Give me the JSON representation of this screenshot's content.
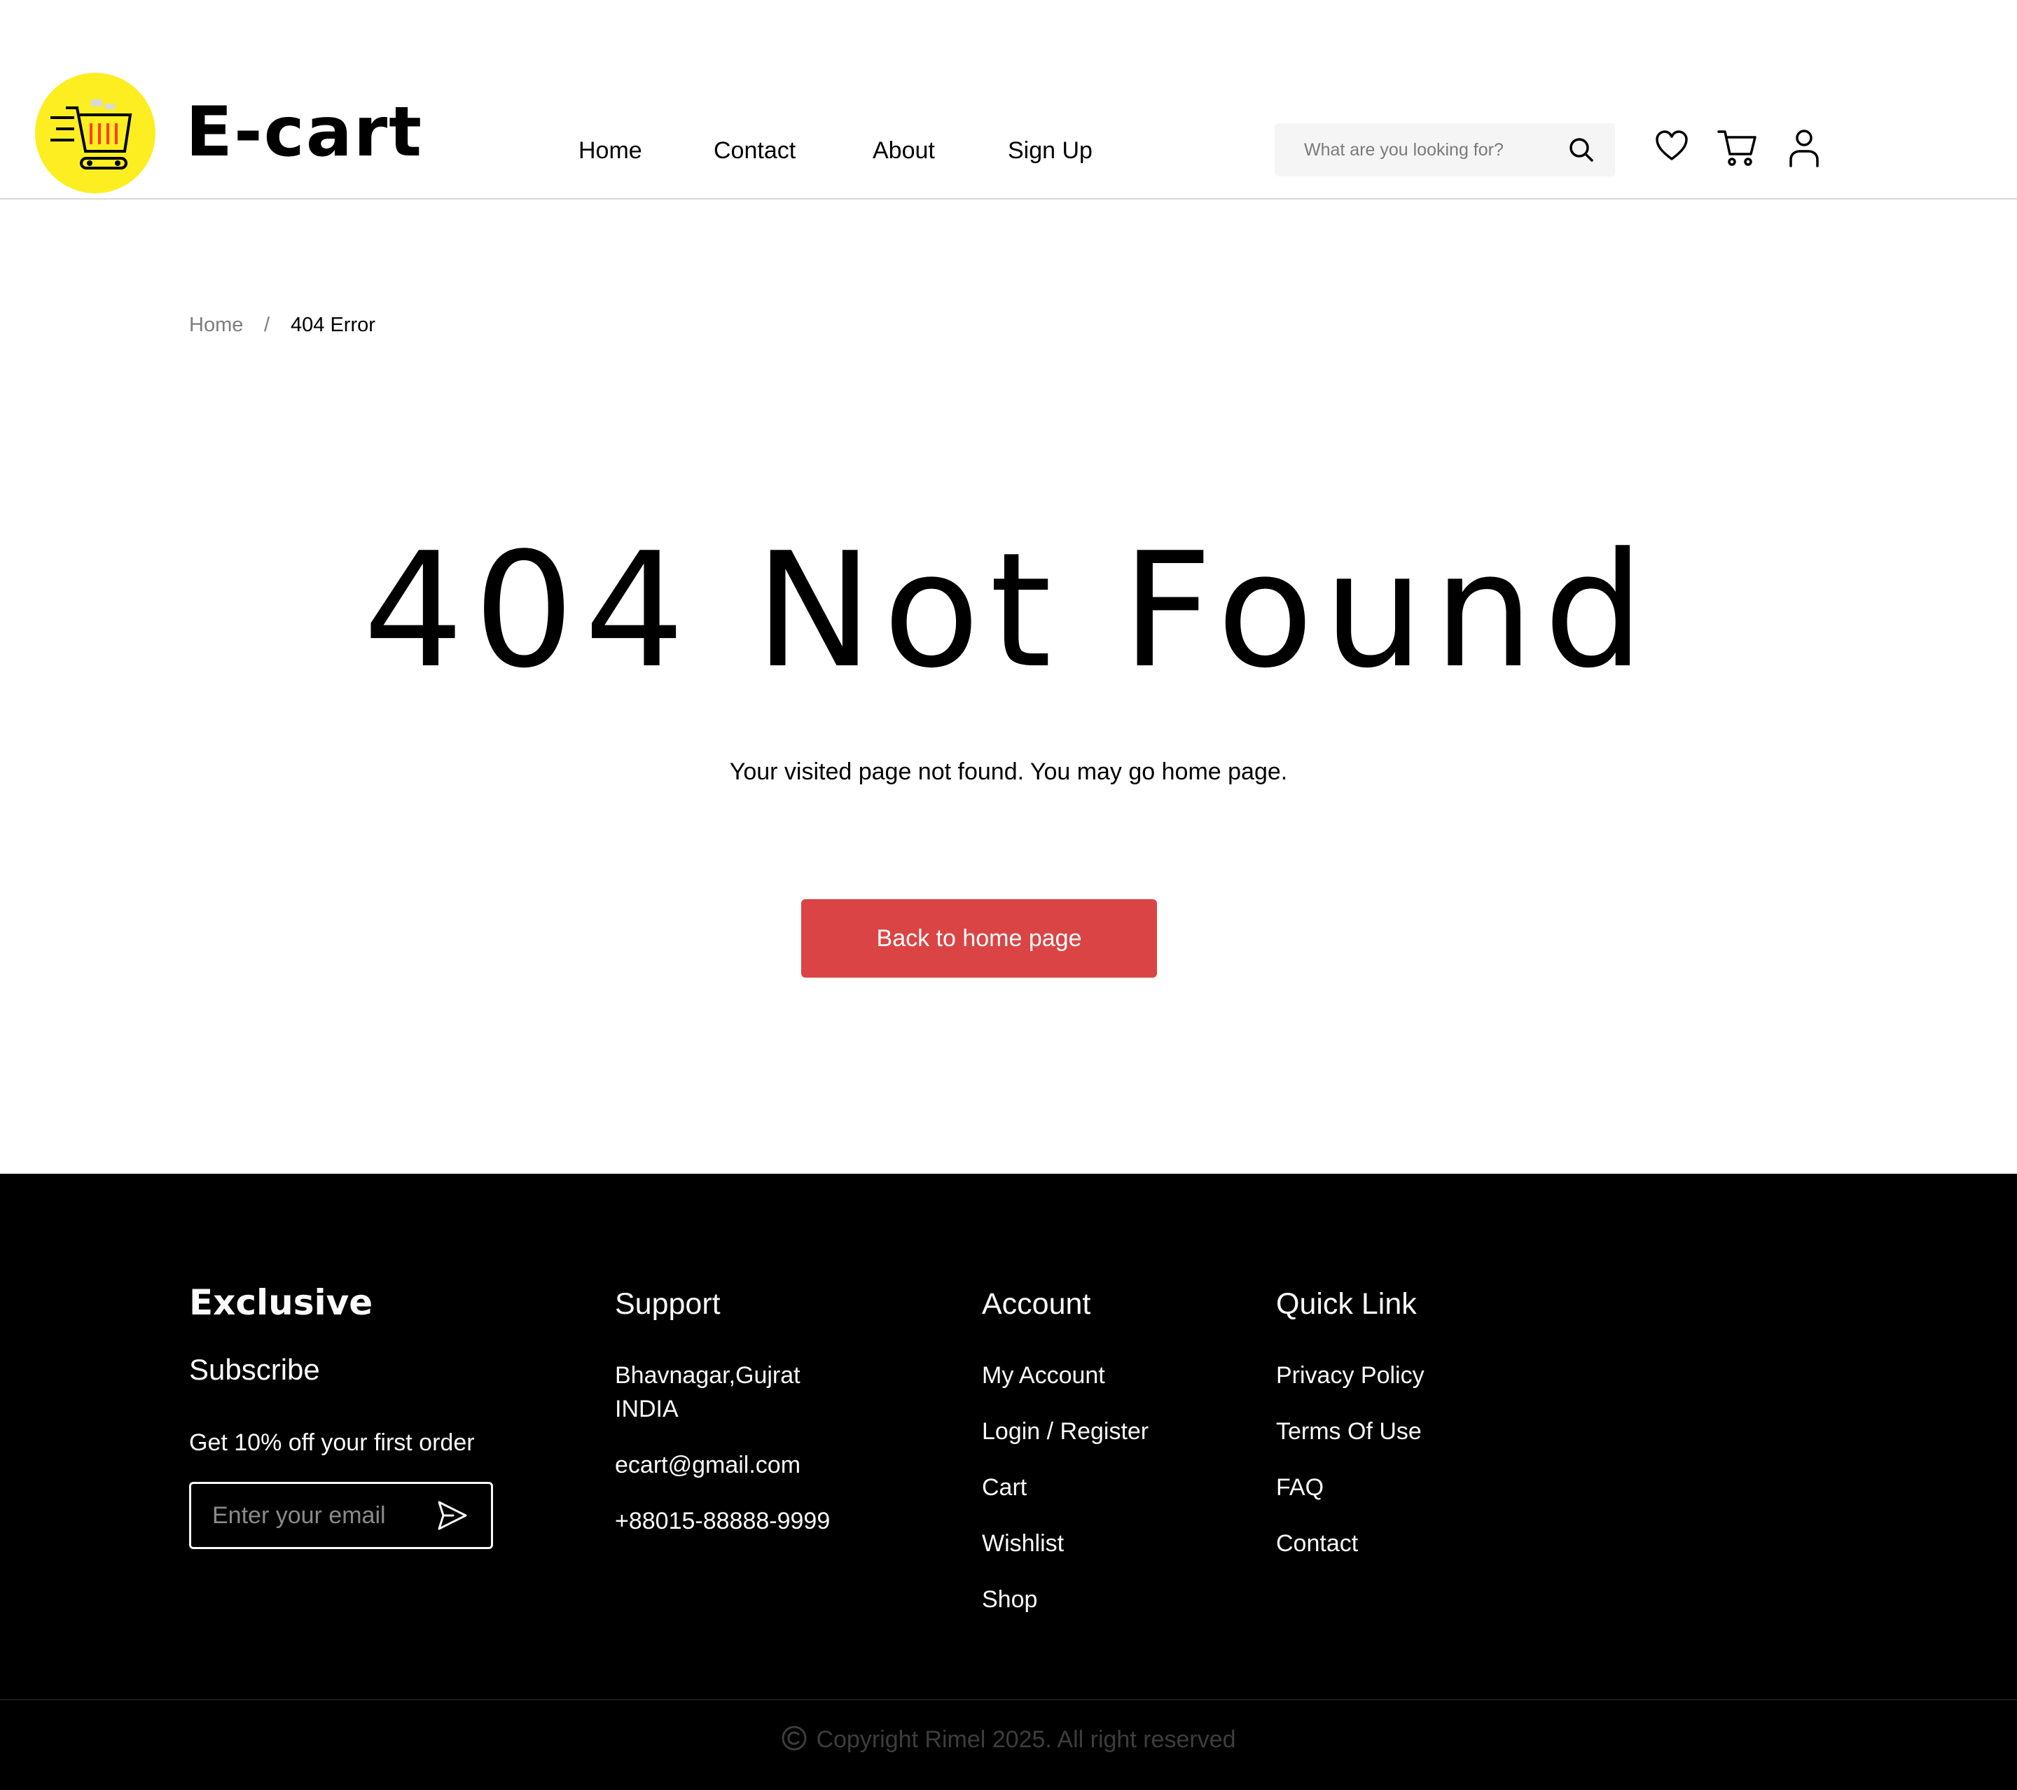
{
  "header": {
    "brand": "E-cart",
    "nav": [
      "Home",
      "Contact",
      "About",
      "Sign Up"
    ],
    "search_placeholder": "What are you looking for?",
    "icons": [
      "search-icon",
      "heart-icon",
      "cart-icon",
      "user-icon"
    ]
  },
  "breadcrumb": {
    "home": "Home",
    "separator": "/",
    "current": "404 Error"
  },
  "main": {
    "title": "404 Not Found",
    "message": "Your visited page not found. You may go home page.",
    "button": "Back to home page"
  },
  "footer": {
    "exclusive": {
      "title": "Exclusive",
      "subtitle": "Subscribe",
      "offer": "Get 10% off your first order",
      "email_placeholder": "Enter your email"
    },
    "support": {
      "title": "Support",
      "address_line1": "Bhavnagar,Gujrat",
      "address_line2": "INDIA",
      "email": "ecart@gmail.com",
      "phone": "+88015-88888-9999"
    },
    "account": {
      "title": "Account",
      "links": [
        "My Account",
        "Login / Register",
        "Cart",
        "Wishlist",
        "Shop"
      ]
    },
    "quick_link": {
      "title": "Quick Link",
      "links": [
        "Privacy Policy",
        "Terms Of Use",
        "FAQ",
        "Contact"
      ]
    },
    "copyright": "Copyright Rimel 2025. All right reserved"
  },
  "colors": {
    "accent": "#DB4444",
    "logo_background": "#FCEE21",
    "footer_background": "#000000",
    "search_background": "#F5F5F5"
  }
}
